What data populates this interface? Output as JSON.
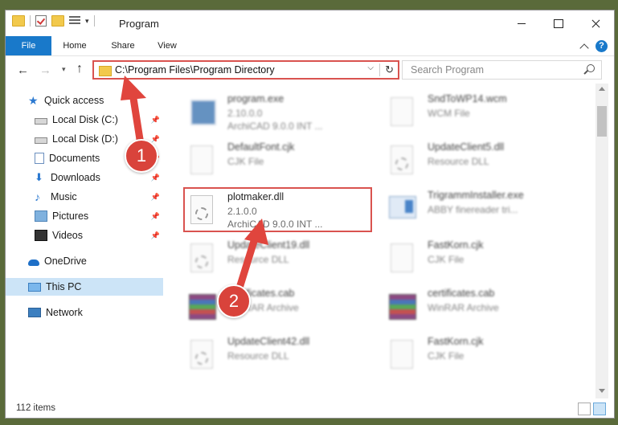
{
  "window": {
    "title": "Program",
    "controls": {
      "minimize": "minimize",
      "maximize": "maximize",
      "close": "close"
    }
  },
  "ribbon": {
    "tabs": [
      "File",
      "Home",
      "Share",
      "View"
    ],
    "help_label": "?"
  },
  "address": {
    "path": "C:\\Program Files\\Program Directory"
  },
  "search": {
    "placeholder": "Search Program"
  },
  "sidebar": {
    "items": [
      {
        "label": "Quick access",
        "icon": "star-icon",
        "pinned": false
      },
      {
        "label": "Local Disk (C:)",
        "icon": "drive-icon",
        "pinned": true
      },
      {
        "label": "Local Disk (D:)",
        "icon": "drive-icon",
        "pinned": true
      },
      {
        "label": "Documents",
        "icon": "documents-icon",
        "pinned": true
      },
      {
        "label": "Downloads",
        "icon": "download-icon",
        "pinned": true
      },
      {
        "label": "Music",
        "icon": "music-icon",
        "pinned": true
      },
      {
        "label": "Pictures",
        "icon": "pictures-icon",
        "pinned": true
      },
      {
        "label": "Videos",
        "icon": "videos-icon",
        "pinned": true
      },
      {
        "label": "OneDrive",
        "icon": "cloud-icon",
        "pinned": false
      },
      {
        "label": "This PC",
        "icon": "computer-icon",
        "pinned": false,
        "selected": true
      },
      {
        "label": "Network",
        "icon": "network-icon",
        "pinned": false
      }
    ]
  },
  "files": [
    {
      "name": "program.exe",
      "line1": "2.10.0.0",
      "line2": "ArchiCAD 9.0.0 INT ...",
      "icon": "exe-icon",
      "blurred": true
    },
    {
      "name": "SndToWP14.wcm",
      "line1": "WCM File",
      "line2": "",
      "icon": "document-icon",
      "blurred": true
    },
    {
      "name": "DefaultFont.cjk",
      "line1": "CJK File",
      "line2": "",
      "icon": "document-icon",
      "blurred": true
    },
    {
      "name": "UpdateClient5.dll",
      "line1": "Resource DLL",
      "line2": "",
      "icon": "dll-icon",
      "blurred": true
    },
    {
      "name": "plotmaker.dll",
      "line1": "2.1.0.0",
      "line2": "ArchiCAD 9.0.0 INT ...",
      "icon": "dll-icon",
      "blurred": false
    },
    {
      "name": "TrigrammInstaller.exe",
      "line1": "ABBY finereader tri...",
      "line2": "",
      "icon": "installer-icon",
      "blurred": true
    },
    {
      "name": "UpdateClient19.dll",
      "line1": "Resource DLL",
      "line2": "",
      "icon": "dll-icon",
      "blurred": true
    },
    {
      "name": "FastKorn.cjk",
      "line1": "CJK File",
      "line2": "",
      "icon": "document-icon",
      "blurred": true
    },
    {
      "name": "certificates.cab",
      "line1": "WinRAR Archive",
      "line2": "",
      "icon": "winrar-icon",
      "blurred": true
    },
    {
      "name": "certificates.cab",
      "line1": "WinRAR Archive",
      "line2": "",
      "icon": "winrar-icon",
      "blurred": true
    },
    {
      "name": "UpdateClient42.dll",
      "line1": "Resource DLL",
      "line2": "",
      "icon": "dll-icon",
      "blurred": true
    },
    {
      "name": "FastKorn.cjk",
      "line1": "CJK File",
      "line2": "",
      "icon": "document-icon",
      "blurred": true
    }
  ],
  "status": {
    "item_count": "112 items"
  },
  "annotations": {
    "step1": "1",
    "step2": "2",
    "color": "#d9433b"
  }
}
